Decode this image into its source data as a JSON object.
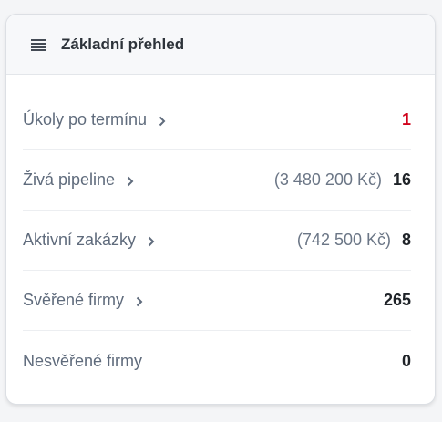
{
  "header": {
    "title": "Základní přehled"
  },
  "rows": [
    {
      "label": "Úkoly po termínu",
      "amount": "",
      "count": "1"
    },
    {
      "label": "Živá pipeline",
      "amount": "(3 480 200 Kč)",
      "count": "16"
    },
    {
      "label": "Aktivní zakázky",
      "amount": "(742 500 Kč)",
      "count": "8"
    },
    {
      "label": "Svěřené firmy",
      "amount": "",
      "count": "265"
    },
    {
      "label": "Nesvěřené firmy",
      "amount": "",
      "count": "0"
    }
  ],
  "colors": {
    "alert": "#d0021b",
    "label": "#5f6b7c",
    "value": "#1f2328"
  },
  "icons": {
    "header": "menu-icon",
    "row_link": "chevron-right-icon"
  }
}
